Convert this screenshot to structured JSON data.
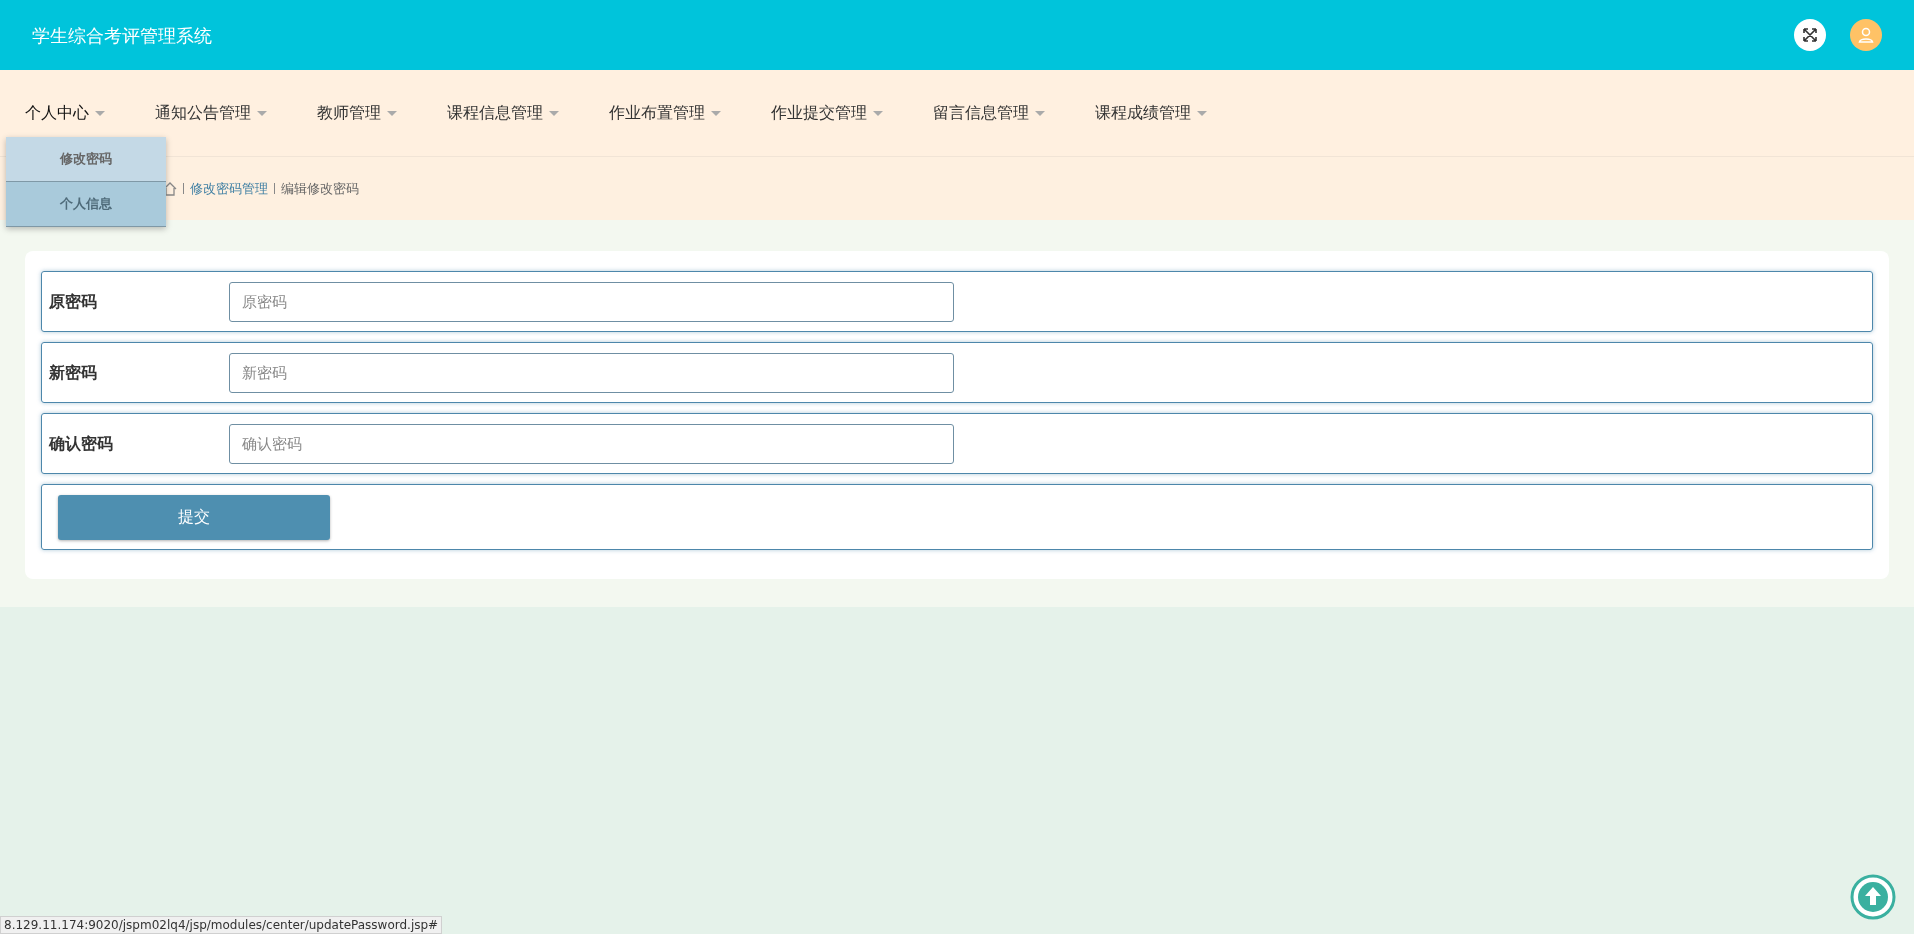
{
  "header": {
    "title": "学生综合考评管理系统"
  },
  "nav": [
    {
      "label": "个人中心",
      "expanded": true,
      "menu": [
        {
          "label": "修改密码",
          "hovered": false
        },
        {
          "label": "个人信息",
          "hovered": true
        }
      ]
    },
    {
      "label": "通知公告管理"
    },
    {
      "label": "教师管理"
    },
    {
      "label": "课程信息管理"
    },
    {
      "label": "作业布置管理"
    },
    {
      "label": "作业提交管理"
    },
    {
      "label": "留言信息管理"
    },
    {
      "label": "课程成绩管理"
    }
  ],
  "breadcrumb": [
    {
      "label": "修改密码管理",
      "kind": "link"
    },
    {
      "label": "编辑修改密码",
      "kind": "current"
    }
  ],
  "form": {
    "fields": [
      {
        "label": "原密码",
        "placeholder": "原密码"
      },
      {
        "label": "新密码",
        "placeholder": "新密码"
      },
      {
        "label": "确认密码",
        "placeholder": "确认密码"
      }
    ],
    "submit": "提交"
  },
  "status_bar": {
    "url": "8.129.11.174:9020/jspm02lq4/jsp/modules/center/updatePassword.jsp#"
  }
}
